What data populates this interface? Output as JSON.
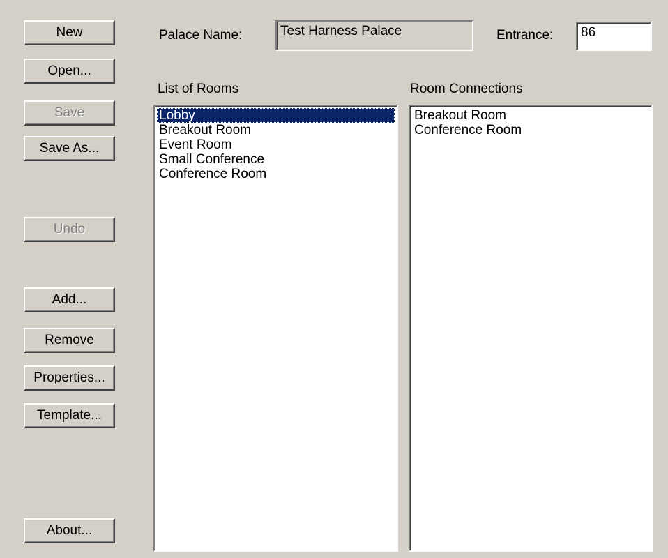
{
  "buttons": {
    "new": "New",
    "open": "Open...",
    "save": "Save",
    "save_as": "Save As...",
    "undo": "Undo",
    "add": "Add...",
    "remove": "Remove",
    "properties": "Properties...",
    "template": "Template...",
    "about": "About..."
  },
  "palace": {
    "name_label": "Palace Name:",
    "name_value": "Test Harness Palace",
    "entrance_label": "Entrance:",
    "entrance_value": "86"
  },
  "rooms": {
    "header": "List of Rooms",
    "items": [
      "Lobby",
      "Breakout Room",
      "Event Room",
      "Small Conference",
      "Conference Room"
    ],
    "selected": "Lobby"
  },
  "connections": {
    "header": "Room Connections",
    "items": [
      "Breakout Room",
      "Conference Room"
    ]
  }
}
